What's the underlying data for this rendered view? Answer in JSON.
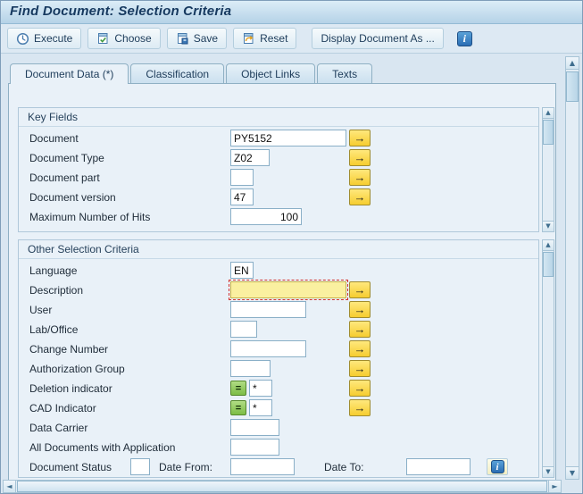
{
  "window": {
    "title": "Find Document: Selection Criteria"
  },
  "toolbar": {
    "buttons": [
      {
        "label": "Execute"
      },
      {
        "label": "Choose"
      },
      {
        "label": "Save"
      },
      {
        "label": "Reset"
      },
      {
        "label": "Display Document As ..."
      }
    ]
  },
  "tabs": [
    {
      "label": "Document Data (*)",
      "active": true
    },
    {
      "label": "Classification",
      "active": false
    },
    {
      "label": "Object Links",
      "active": false
    },
    {
      "label": "Texts",
      "active": false
    }
  ],
  "groups": [
    {
      "title": "Key Fields",
      "rows": [
        {
          "label": "Document",
          "value": "PY5152"
        },
        {
          "label": "Document Type",
          "value": "Z02"
        },
        {
          "label": "Document part",
          "value": ""
        },
        {
          "label": "Document version",
          "value": "47"
        },
        {
          "label": "Maximum Number of Hits",
          "value": "100"
        }
      ]
    },
    {
      "title": "Other Selection Criteria",
      "rows": [
        {
          "label": "Language",
          "value": "EN"
        },
        {
          "label": "Description",
          "value": ""
        },
        {
          "label": "User",
          "value": ""
        },
        {
          "label": "Lab/Office",
          "value": ""
        },
        {
          "label": "Change Number",
          "value": ""
        },
        {
          "label": "Authorization Group",
          "value": ""
        },
        {
          "label": "Deletion indicator",
          "value": "*"
        },
        {
          "label": "CAD Indicator",
          "value": "*"
        },
        {
          "label": "Data Carrier",
          "value": ""
        },
        {
          "label": "All Documents with Application",
          "value": ""
        },
        {
          "label": "Document Status",
          "value": ""
        }
      ]
    }
  ],
  "status_row": {
    "date_from_label": "Date From:",
    "date_from_value": "",
    "date_to_label": "Date To:",
    "date_to_value": ""
  },
  "icons": {
    "multiselect_arrow": "→",
    "select_equals": "=",
    "info_letter": "i",
    "scroll_up": "▲",
    "scroll_down": "▼",
    "scroll_left": "◄",
    "scroll_right": "►"
  },
  "colors": {
    "accent_yellow": "#f6cd30",
    "accent_green": "#7cbd45",
    "info_blue": "#2a6db3",
    "focus_field_bg": "#faf0a0",
    "focus_border_red": "#d2302a",
    "titlebar_blue": "#b5d2e7"
  }
}
